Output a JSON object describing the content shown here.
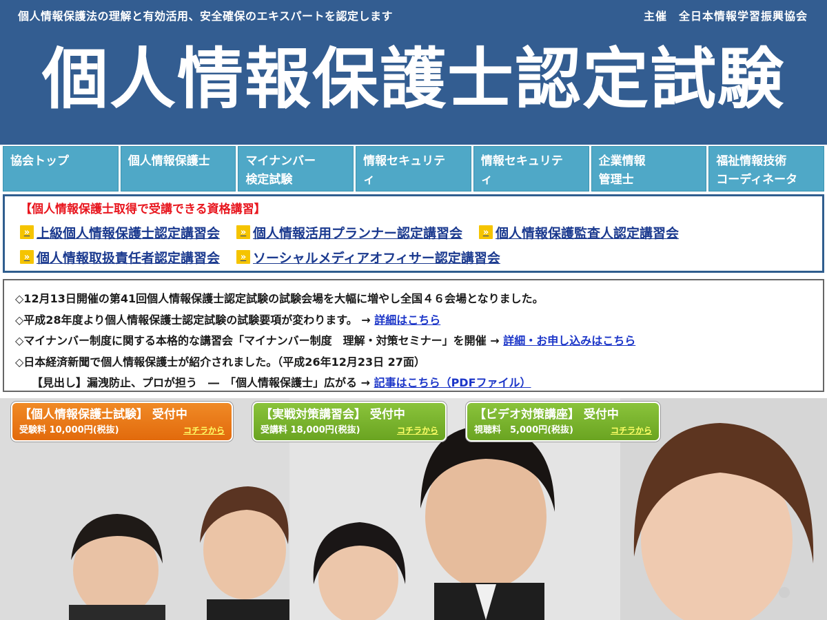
{
  "header": {
    "tagline": "個人情報保護法の理解と有効活用、安全確保のエキスパートを認定します",
    "organizer": "主催　全日本情報学習振興協会",
    "title": "個人情報保護士認定試験"
  },
  "nav": {
    "items": [
      {
        "line1": "協会トップ",
        "line2": ""
      },
      {
        "line1": "個人情報保護士",
        "line2": ""
      },
      {
        "line1": "マイナンバー",
        "line2": "検定試験"
      },
      {
        "line1": "情報セキュリテ",
        "line2": "ィ"
      },
      {
        "line1": "情報セキュリテ",
        "line2": "ィ"
      },
      {
        "line1": "企業情報",
        "line2": "管理士"
      },
      {
        "line1": "福祉情報技術",
        "line2": "コーディネータ"
      }
    ]
  },
  "courses": {
    "title": "【個人情報保護士取得で受講できる資格講習】",
    "links": [
      "上級個人情報保護士認定講習会",
      "個人情報活用プランナー認定講習会",
      "個人情報保護監査人認定講習会",
      "個人情報取扱責任者認定講習会",
      "ソーシャルメディアオフィサー認定講習会"
    ]
  },
  "news": {
    "line1": "◇12月13日開催の第41回個人情報保護士認定試験の試験会場を大幅に増やし全国４６会場となりました。",
    "line2_text": "◇平成28年度より個人情報保護士認定試験の試験要項が変わります。 → ",
    "line2_link": "詳細はこちら",
    "line3_text": "◇マイナンバー制度に関する本格的な講習会「マイナンバー制度　理解・対策セミナー」を開催 → ",
    "line3_link": "詳細・お申し込みはこちら",
    "line4": "◇日本経済新聞で個人情報保護士が紹介されました。（平成26年12月23日 27面）",
    "line5_text": "【見出し】漏洩防止、プロが担う　―　「個人情報保護士」広がる → ",
    "line5_link": "記事はこちら（PDFファイル）"
  },
  "badges": [
    {
      "title": "【個人情報保護士試験】 受付中",
      "fee": "受験料 10,000円(税抜)",
      "link": "コチラから",
      "color": "#e8751a"
    },
    {
      "title": "【実戦対策講習会】 受付中",
      "fee": "受講料 18,000円(税抜)",
      "link": "コチラから",
      "color": "#7ab52e"
    },
    {
      "title": "【ビデオ対策講座】 受付中",
      "fee": "視聴料　5,000円(税抜)",
      "link": "コチラから",
      "color": "#7ab52e"
    }
  ],
  "colors": {
    "header_bg": "#335d91",
    "nav_bg": "#4fa8c7",
    "course_title": "#e8161e",
    "course_link": "#1b3a8f",
    "news_link": "#1b35c8"
  }
}
